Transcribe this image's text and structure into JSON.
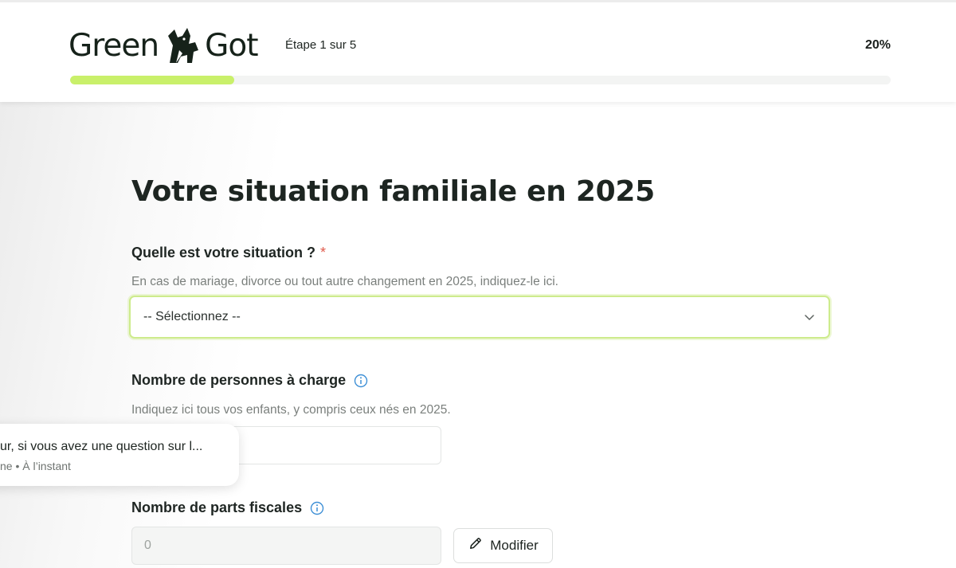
{
  "header": {
    "logo_left": "Green",
    "logo_right": "Got",
    "step_label": "Étape 1 sur 5",
    "progress_percent_label": "20%",
    "progress_fraction": 0.2
  },
  "form": {
    "title": "Votre situation familiale en 2025",
    "situation": {
      "label": "Quelle est votre situation ?",
      "required_mark": "*",
      "hint": "En cas de mariage, divorce ou tout autre changement en 2025, indiquez-le ici.",
      "selected": "-- Sélectionnez --"
    },
    "dependents": {
      "label": "Nombre de personnes à charge",
      "hint": "Indiquez ici tous vos enfants, y compris ceux nés en 2025.",
      "value": ""
    },
    "tax_shares": {
      "label": "Nombre de parts fiscales",
      "value": "0",
      "modify_label": "Modifier"
    }
  },
  "chat": {
    "message": "ur, si vous avez une question sur l...",
    "meta": "ne • À l’instant"
  },
  "colors": {
    "accent": "#c9f06a",
    "info": "#3d8fd6",
    "required": "#e05a4b"
  },
  "icons": [
    "fox-logo-icon",
    "chevron-down-icon",
    "info-icon",
    "pencil-icon"
  ]
}
